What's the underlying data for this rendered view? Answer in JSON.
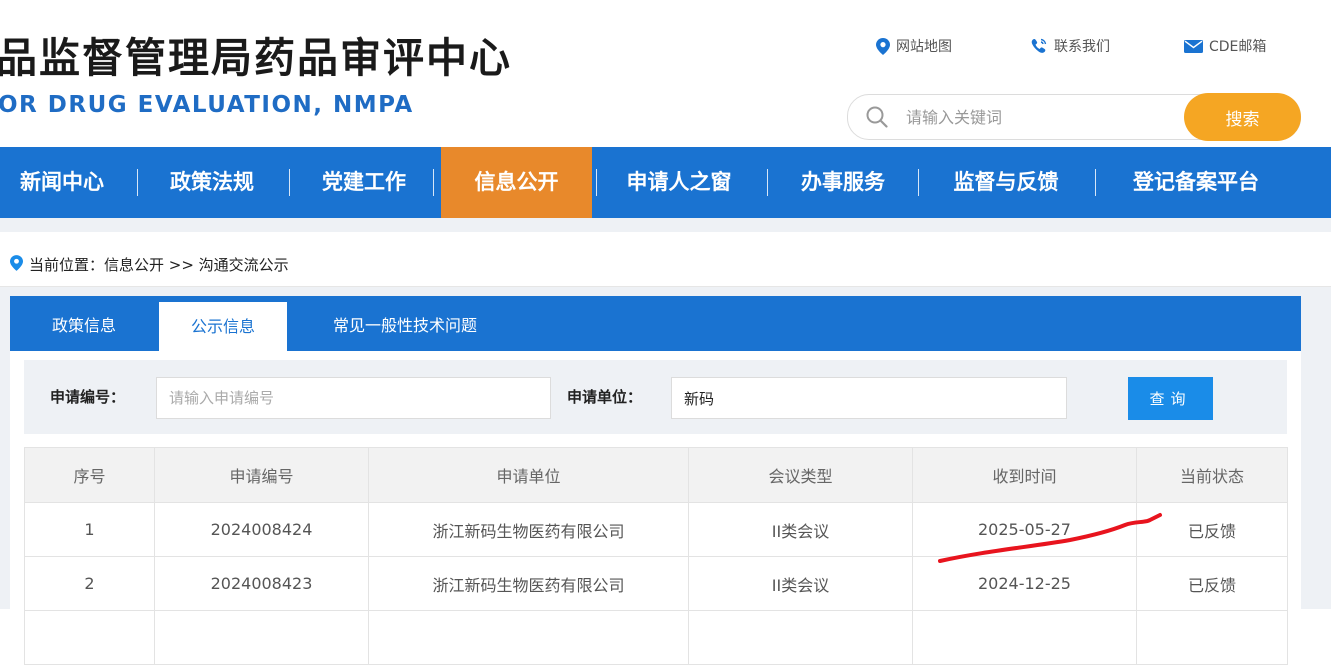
{
  "header": {
    "title_cn": "品监督管理局药品审评中心",
    "title_en": "OR DRUG EVALUATION, NMPA",
    "links": [
      {
        "label": "网站地图",
        "icon": "map-pin-icon"
      },
      {
        "label": "联系我们",
        "icon": "phone-icon"
      },
      {
        "label": "CDE邮箱",
        "icon": "mail-icon"
      }
    ],
    "search": {
      "placeholder": "请输入关键词",
      "button": "搜索"
    }
  },
  "nav": {
    "items": [
      {
        "label": "新闻中心"
      },
      {
        "label": "政策法规"
      },
      {
        "label": "党建工作"
      },
      {
        "label": "信息公开",
        "active": true
      },
      {
        "label": "申请人之窗"
      },
      {
        "label": "办事服务"
      },
      {
        "label": "监督与反馈"
      },
      {
        "label": "登记备案平台"
      }
    ]
  },
  "breadcrumb": {
    "text": "当前位置：信息公开 >> 沟通交流公示"
  },
  "tabs": [
    {
      "label": "政策信息"
    },
    {
      "label": "公示信息",
      "active": true
    },
    {
      "label": "常见一般性技术问题"
    }
  ],
  "filter": {
    "app_no_label": "申请编号：",
    "app_no_placeholder": "请输入申请编号",
    "app_no_value": "",
    "unit_label": "申请单位：",
    "unit_value": "新码",
    "query_button": "查询"
  },
  "table": {
    "headers": [
      "序号",
      "申请编号",
      "申请单位",
      "会议类型",
      "收到时间",
      "当前状态"
    ],
    "rows": [
      [
        "1",
        "2024008424",
        "浙江新码生物医药有限公司",
        "II类会议",
        "2025-05-27",
        "已反馈"
      ],
      [
        "2",
        "2024008423",
        "浙江新码生物医药有限公司",
        "II类会议",
        "2024-12-25",
        "已反馈"
      ]
    ]
  },
  "colors": {
    "nav_blue": "#1a73d1",
    "active_orange": "#e8892b",
    "search_orange": "#f5a623",
    "query_blue": "#1a8ce8",
    "annotation_red": "#e8141e"
  }
}
